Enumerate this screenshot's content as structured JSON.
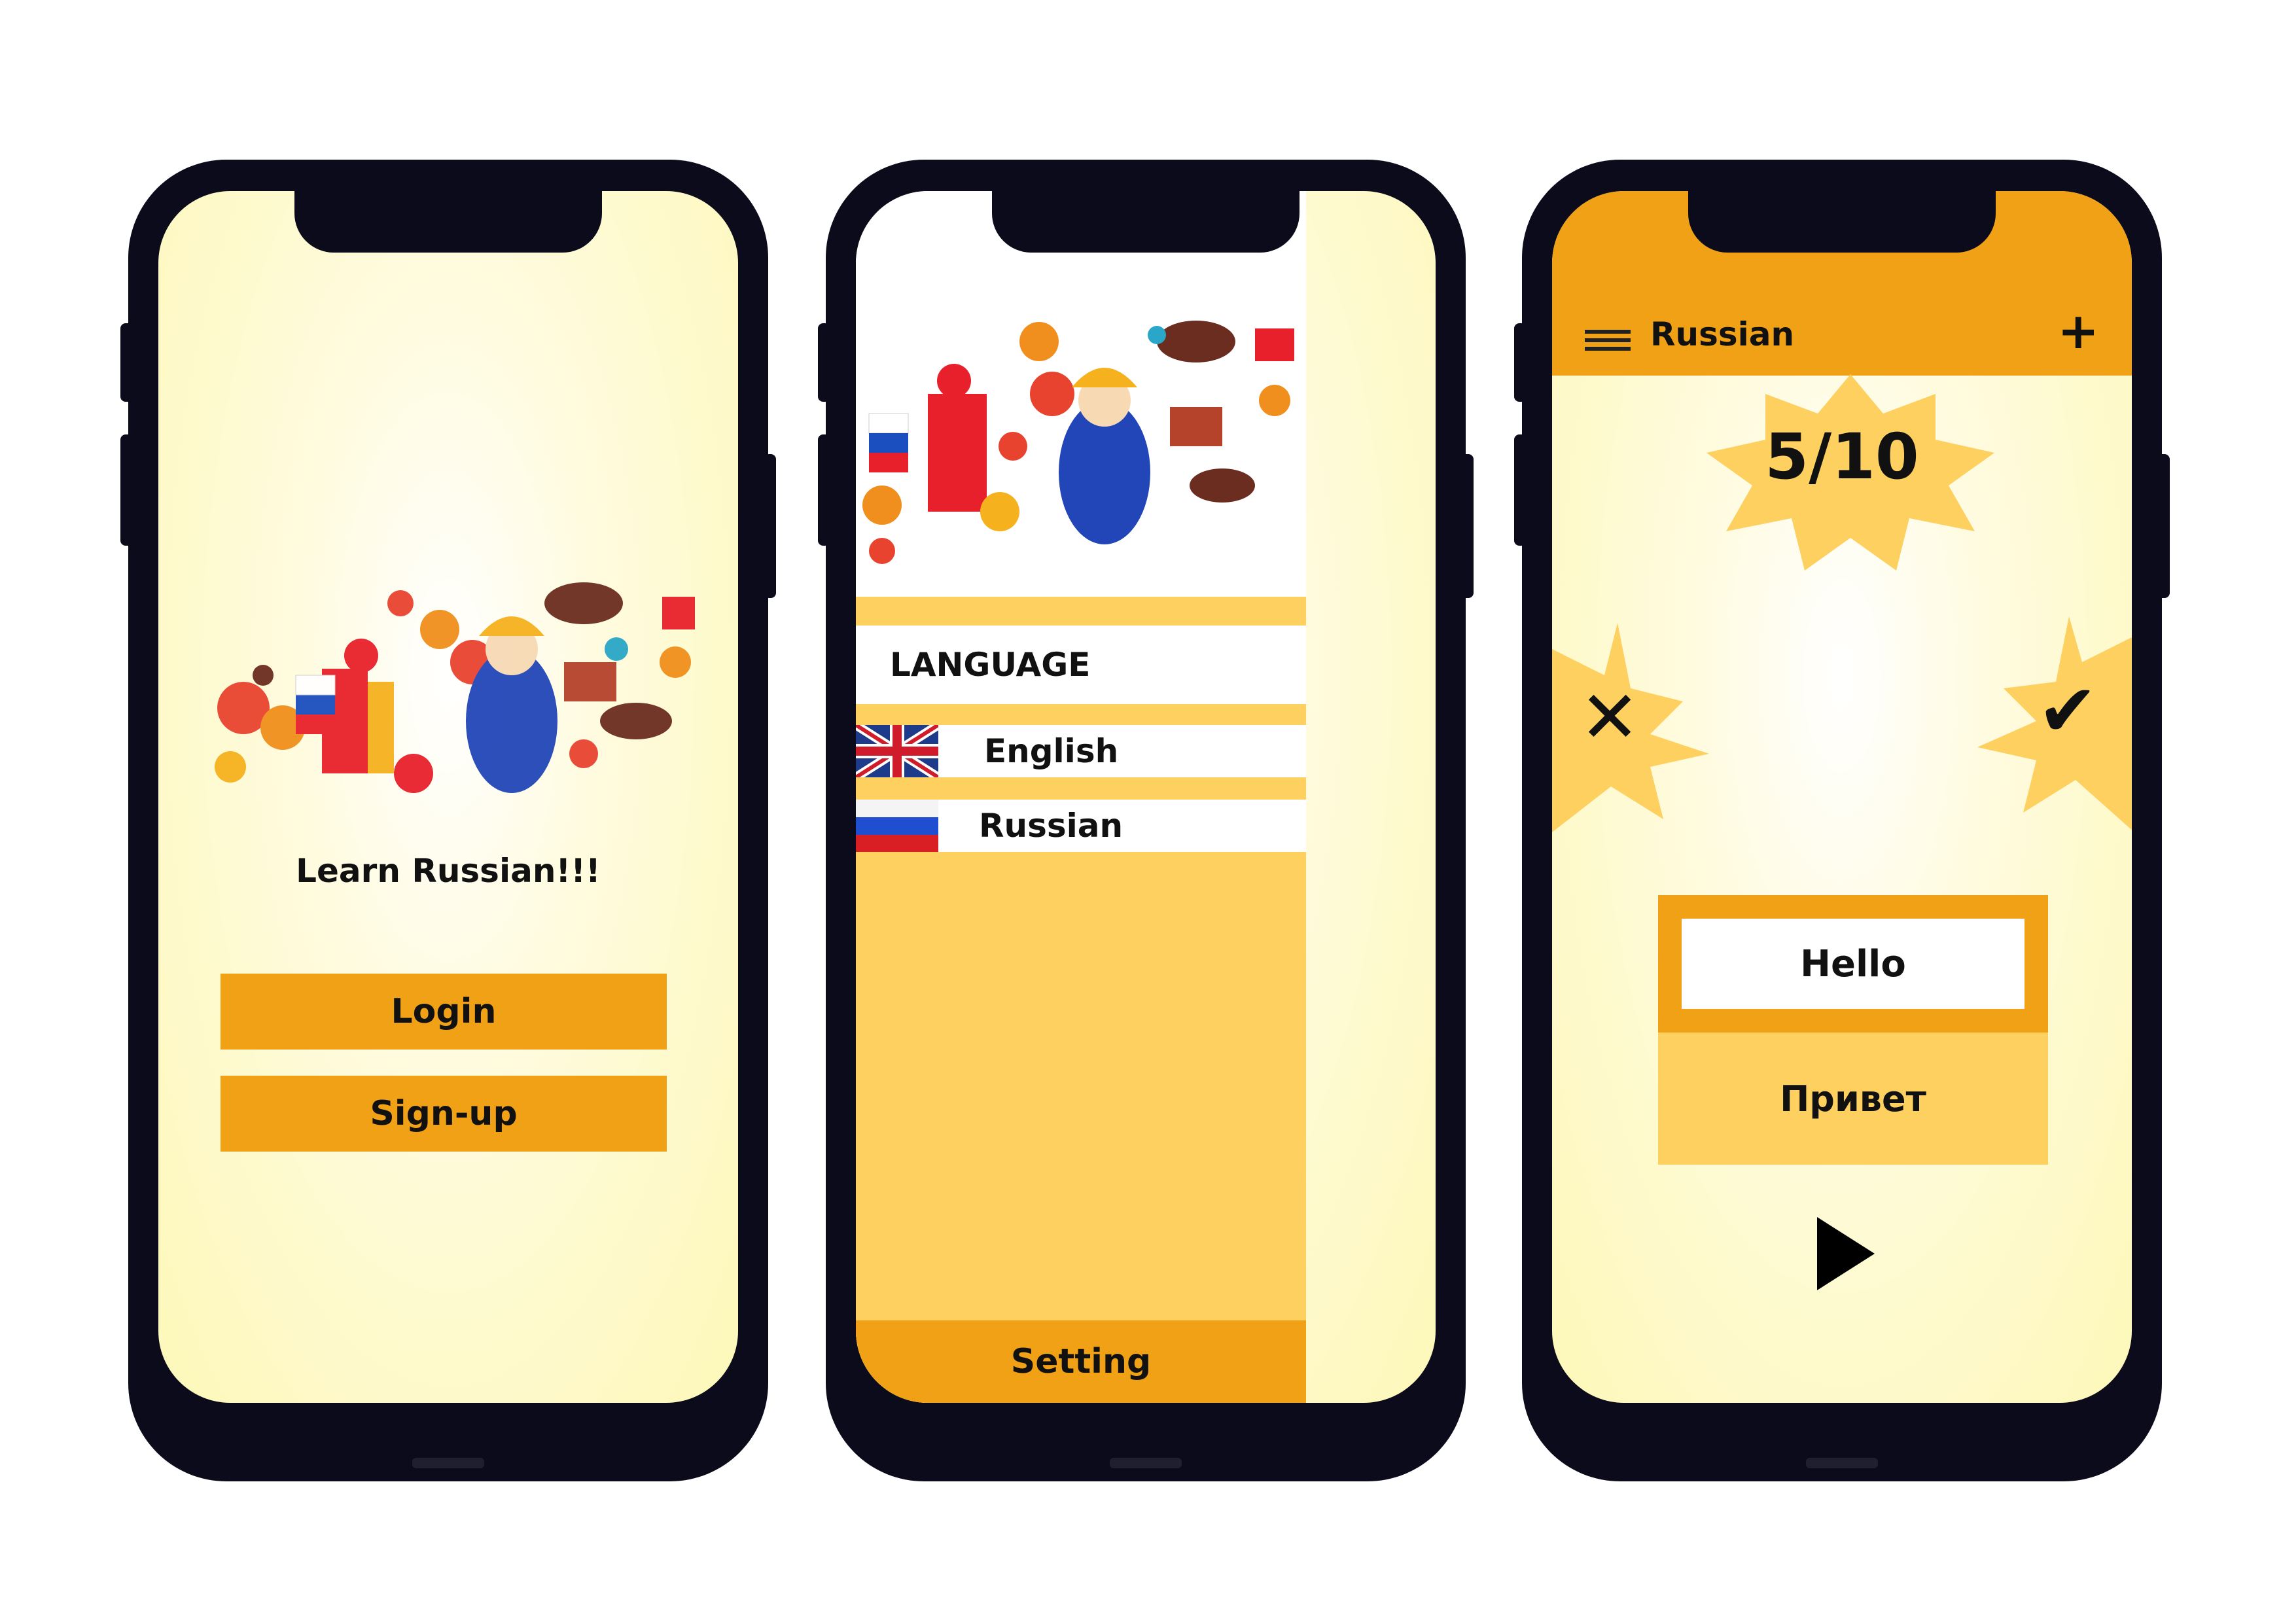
{
  "screen1": {
    "title": "Learn Russian!!!",
    "login_label": "Login",
    "signup_label": "Sign-up"
  },
  "screen2": {
    "section_heading": "LANGUAGE",
    "languages": [
      {
        "label": "English",
        "flag": "uk-flag-icon"
      },
      {
        "label": "Russian",
        "flag": "russia-flag-icon"
      }
    ],
    "footer_label": "Setting"
  },
  "screen3": {
    "header_title": "Russian",
    "score": "5/10",
    "word": "Hello",
    "translation": "Привет",
    "icons": [
      "menu-icon",
      "plus-icon",
      "cross-icon",
      "check-icon",
      "play-icon"
    ]
  },
  "colors": {
    "accent_orange": "#f0a115",
    "light_orange": "#fdd060",
    "screen_bg": "#fdf8b8",
    "phone_frame": "#0b0b1c"
  }
}
